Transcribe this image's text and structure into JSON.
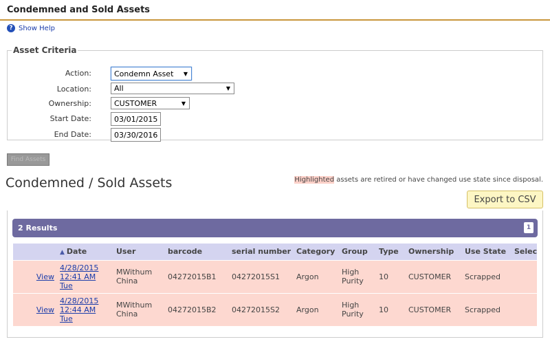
{
  "page": {
    "title": "Condemned and Sold Assets",
    "help_label": "Show Help"
  },
  "criteria": {
    "legend": "Asset Criteria",
    "action": {
      "label": "Action:",
      "value": "Condemn Asset"
    },
    "location": {
      "label": "Location:",
      "value": "All"
    },
    "ownership": {
      "label": "Ownership:",
      "value": "CUSTOMER"
    },
    "start_date": {
      "label": "Start Date:",
      "value": "03/01/2015"
    },
    "end_date": {
      "label": "End Date:",
      "value": "03/30/2016"
    }
  },
  "submit_label": "Find Assets",
  "results_section": {
    "title": "Condemned / Sold Assets",
    "note_highlight": "Highlighted",
    "note_text": " assets are retired or have changed use state since disposal.",
    "export_label": "Export to CSV",
    "count_label": "2 Results",
    "page": "1"
  },
  "table": {
    "headers": [
      "",
      "Date",
      "User",
      "barcode",
      "serial number",
      "Category",
      "Group",
      "Type",
      "Ownership",
      "Use State",
      "Select"
    ],
    "rows": [
      {
        "view": "View",
        "date_line1": "4/28/2015",
        "date_line2": "12:41 AM",
        "date_line3": "Tue",
        "user_line1": "MWithum",
        "user_line2": "China",
        "barcode": "04272015B1",
        "serial": "04272015S1",
        "category": "Argon",
        "group_line1": "High",
        "group_line2": "Purity",
        "type": "10",
        "ownership": "CUSTOMER",
        "use_state": "Scrapped"
      },
      {
        "view": "View",
        "date_line1": "4/28/2015",
        "date_line2": "12:44 AM",
        "date_line3": "Tue",
        "user_line1": "MWithum",
        "user_line2": "China",
        "barcode": "04272015B2",
        "serial": "04272015S2",
        "category": "Argon",
        "group_line1": "High",
        "group_line2": "Purity",
        "type": "10",
        "ownership": "CUSTOMER",
        "use_state": "Scrapped"
      }
    ]
  },
  "colors": {
    "header_rule": "#c8963c",
    "results_bar": "#6e6aa0",
    "row_highlight": "#fdd8d0",
    "export_bg": "#fdf6c4"
  },
  "icons": {
    "help": "question-circle-icon",
    "sort": "sort-ascending-icon"
  }
}
